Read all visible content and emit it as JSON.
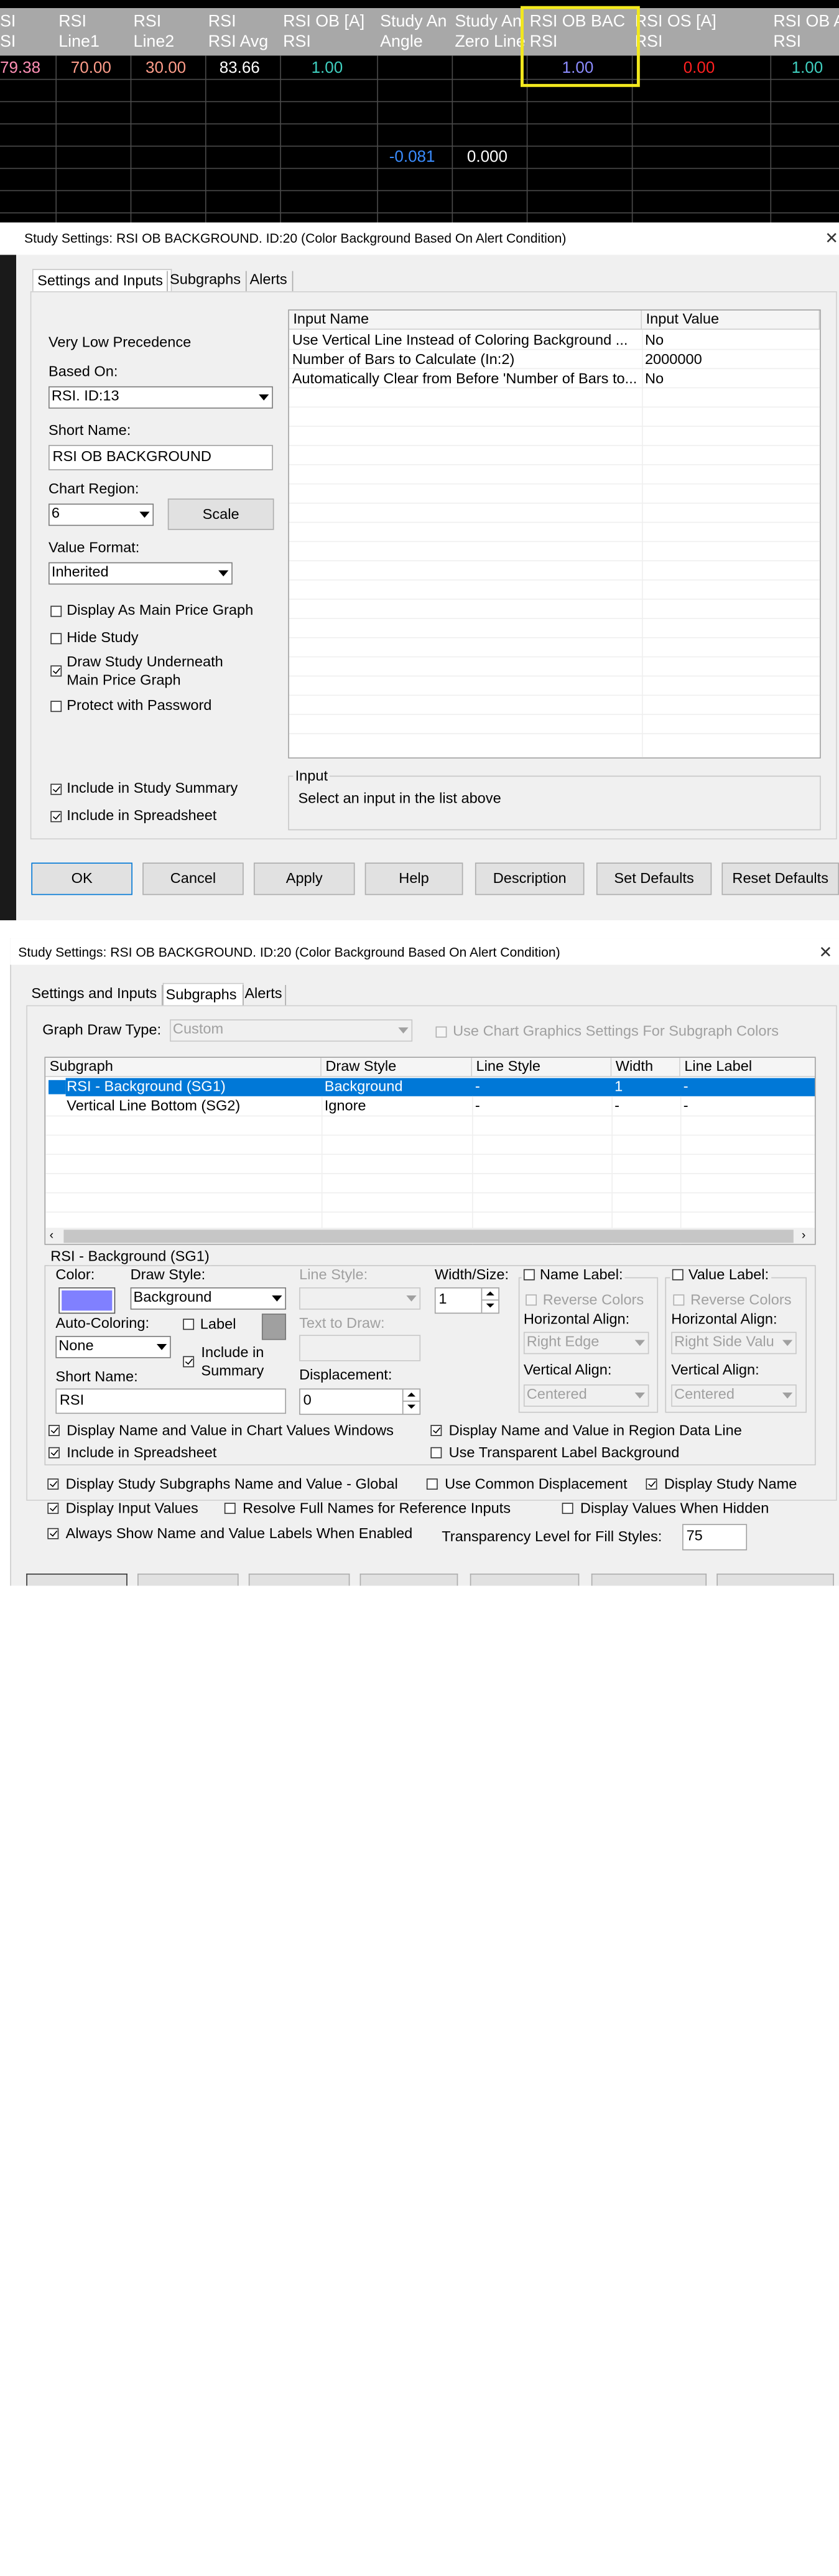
{
  "sheet": {
    "headers": [
      {
        "line1": "SI",
        "line2": "SI"
      },
      {
        "line1": "RSI",
        "line2": "Line1"
      },
      {
        "line1": "RSI",
        "line2": "Line2"
      },
      {
        "line1": "RSI",
        "line2": "RSI Avg"
      },
      {
        "line1": "RSI OB [A]",
        "line2": "RSI"
      },
      {
        "line1": "Study An",
        "line2": "Angle"
      },
      {
        "line1": "Study An",
        "line2": "Zero Line"
      },
      {
        "line1": "RSI OB BAC",
        "line2": "RSI"
      },
      {
        "line1": "RSI OS [A]",
        "line2": "RSI"
      },
      {
        "line1": "RSI OB A",
        "line2": "RSI"
      }
    ],
    "row1": [
      "79.38",
      "70.00",
      "30.00",
      "83.66",
      "1.00",
      "1.00",
      "0.00",
      "1.00"
    ],
    "row4": [
      "-0.081",
      "0.000"
    ]
  },
  "dialog1": {
    "title": "Study Settings: RSI OB BACKGROUND. ID:20 (Color Background Based On Alert Condition)",
    "tabs": [
      "Settings and Inputs",
      "Subgraphs",
      "Alerts"
    ],
    "precedence": "Very Low Precedence",
    "based_on_label": "Based On:",
    "based_on_value": "RSI. ID:13",
    "short_name_label": "Short Name:",
    "short_name_value": "RSI OB BACKGROUND",
    "chart_region_label": "Chart Region:",
    "chart_region_value": "6",
    "scale_button": "Scale",
    "value_format_label": "Value Format:",
    "value_format_value": "Inherited",
    "checks": {
      "display_main": "Display As Main Price Graph",
      "hide_study": "Hide Study",
      "draw_under_1": "Draw Study Underneath",
      "draw_under_2": "Main Price Graph",
      "protect": "Protect with Password",
      "include_summary": "Include in Study Summary",
      "include_sheet": "Include in Spreadsheet"
    },
    "inputs_header": [
      "Input Name",
      "Input Value"
    ],
    "inputs": [
      {
        "name": "Use Vertical Line Instead of Coloring Background   ...",
        "value": "No"
      },
      {
        "name": "Number of Bars to Calculate   (In:2)",
        "value": "2000000"
      },
      {
        "name": "Automatically Clear from Before 'Number of Bars to...",
        "value": "No"
      }
    ],
    "input_group_label": "Input",
    "input_hint": "Select an input in the list above",
    "buttons": [
      "OK",
      "Cancel",
      "Apply",
      "Help",
      "Description",
      "Set Defaults",
      "Reset Defaults"
    ]
  },
  "dialog2": {
    "title": "Study Settings: RSI OB BACKGROUND. ID:20 (Color Background Based On Alert Condition)",
    "tabs": [
      "Settings and Inputs",
      "Subgraphs",
      "Alerts"
    ],
    "graph_draw_type_label": "Graph Draw Type:",
    "graph_draw_type_value": "Custom",
    "use_chart_graphics": "Use Chart Graphics Settings For Subgraph Colors",
    "subgraph_headers": [
      "Subgraph",
      "Draw Style",
      "Line Style",
      "Width",
      "Line Label"
    ],
    "subgraphs": [
      {
        "name": "RSI - Background (SG1)",
        "draw_style": "Background",
        "line_style": "-",
        "width": "1",
        "line_label": "-"
      },
      {
        "name": "Vertical Line Bottom (SG2)",
        "draw_style": "Ignore",
        "line_style": "-",
        "width": "-",
        "line_label": "-"
      }
    ],
    "group_label": "RSI - Background (SG1)",
    "color_label": "Color:",
    "color_value": "#8080ff",
    "draw_style_label": "Draw Style:",
    "draw_style_value": "Background",
    "line_style_label": "Line Style:",
    "width_size_label": "Width/Size:",
    "width_size_value": "1",
    "name_label": "Name Label:",
    "value_label": "Value Label:",
    "reverse_colors": "Reverse Colors",
    "horizontal_align": "Horizontal Align:",
    "h_align_name": "Right Edge",
    "h_align_value": "Right Side Valu",
    "vertical_align": "Vertical Align:",
    "v_align_name": "Centered",
    "v_align_value": "Centered",
    "auto_coloring_label": "Auto-Coloring:",
    "auto_coloring_value": "None",
    "label_check": "Label",
    "include_summary_1": "Include in",
    "include_summary_2": "Summary",
    "text_to_draw_label": "Text to Draw:",
    "short_name_label": "Short Name:",
    "short_name_value": "RSI",
    "displacement_label": "Displacement:",
    "displacement_value": "0",
    "opt_display_chart_values": "Display Name and Value in Chart Values Windows",
    "opt_display_region": "Display Name and Value in Region Data Line",
    "opt_include_sheet": "Include in Spreadsheet",
    "opt_transparent": "Use Transparent Label Background",
    "opt_global": "Display Study Subgraphs Name and Value - Global",
    "opt_common_disp": "Use Common Displacement",
    "opt_study_name": "Display Study Name",
    "opt_input_values": "Display Input Values",
    "opt_resolve": "Resolve Full Names for Reference Inputs",
    "opt_hidden": "Display Values When Hidden",
    "opt_always_show": "Always Show Name and Value Labels When Enabled",
    "transparency_label": "Transparency Level for Fill Styles:",
    "transparency_value": "75"
  },
  "colors": {
    "row1": [
      "#ff8fb5",
      "#ff9d8a",
      "#ff9d8a",
      "#ffffff",
      "#3fd0c0",
      "#8c8cff",
      "#ff2020",
      "#3fd0c0"
    ],
    "angle": "#3a8cff",
    "highlight": "#f2e81e",
    "selection": "#0078d7"
  }
}
